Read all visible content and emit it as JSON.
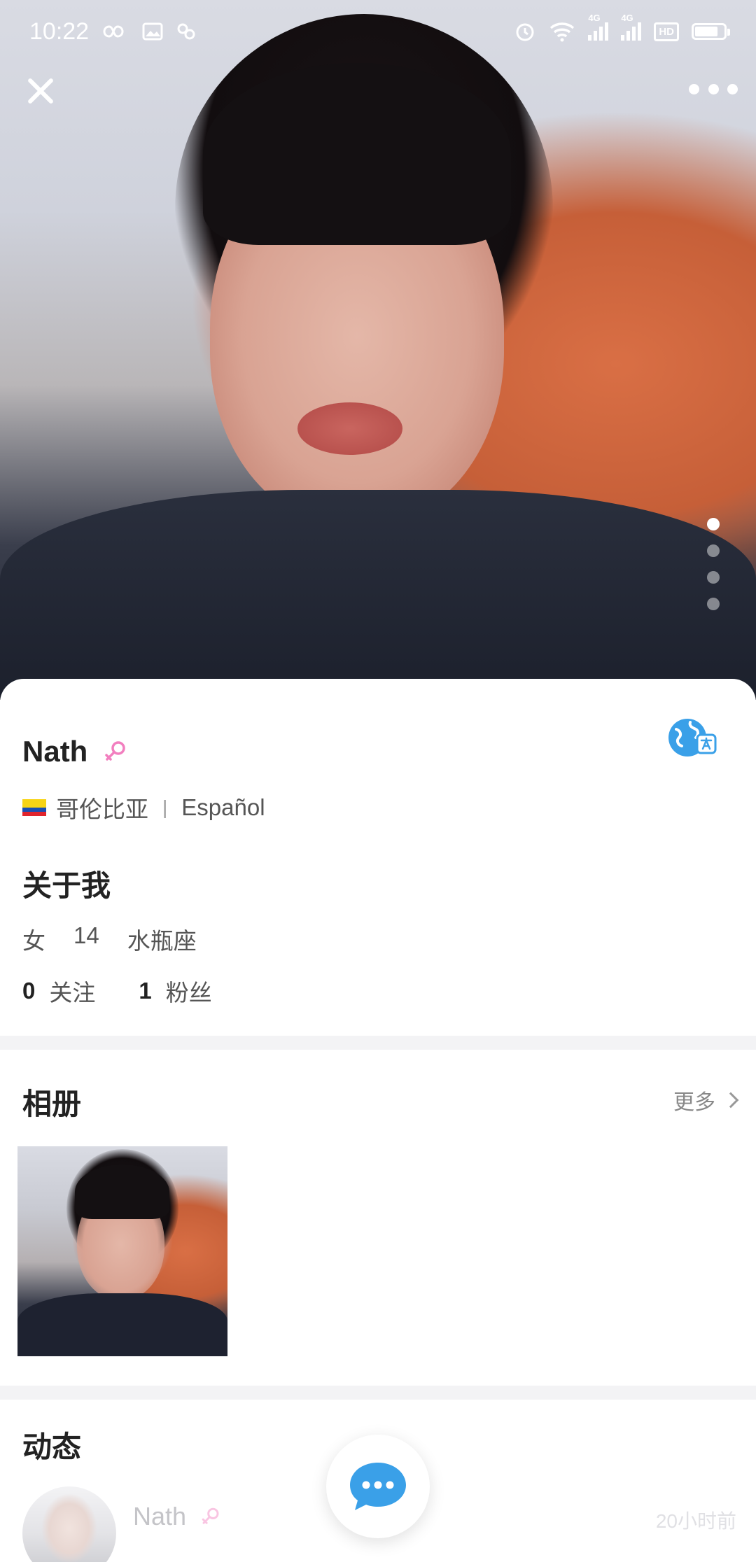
{
  "status_bar": {
    "time": "10:22",
    "left_icons": [
      "infinity-icon",
      "image-icon",
      "link-icon"
    ],
    "right_icons": [
      "alarm-icon",
      "wifi-icon",
      "signal-4g-icon",
      "signal-4g-icon",
      "hd-icon",
      "battery-icon"
    ],
    "signal_1_label": "4G",
    "signal_2_label": "4G",
    "hd_label": "HD",
    "battery_level": 0.8
  },
  "top_controls": {
    "close_icon": "close-icon",
    "more_icon": "more-icon"
  },
  "photo_carousel": {
    "total": 4,
    "active_index": 0
  },
  "profile": {
    "name": "Nath",
    "gender_icon": "female-icon",
    "country": "哥伦比亚",
    "separator": "|",
    "language": "Español",
    "translate_icon": "translate-icon"
  },
  "about": {
    "title": "关于我",
    "gender": "女",
    "age": "14",
    "zodiac": "水瓶座",
    "following_count": "0",
    "following_label": "关注",
    "followers_count": "1",
    "followers_label": "粉丝"
  },
  "album": {
    "title": "相册",
    "more_label": "更多"
  },
  "moments": {
    "title": "动态",
    "post_author": "Nath",
    "post_time": "20小时前"
  },
  "colors": {
    "accent_pink": "#f27fbf",
    "accent_blue": "#3aa0e8",
    "flag_yellow": "#f7d417",
    "flag_blue": "#1a4fb3",
    "flag_red": "#e0242d"
  }
}
